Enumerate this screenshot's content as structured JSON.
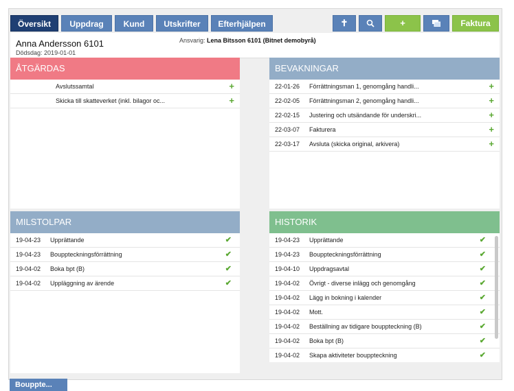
{
  "nav": {
    "tabs": [
      "Översikt",
      "Uppdrag",
      "Kund",
      "Utskrifter",
      "Efterhjälpen"
    ],
    "active_tab": "Översikt"
  },
  "toolbar": {
    "pin_icon": "pin-icon",
    "search_icon": "search-icon",
    "add_label": "+",
    "window_icon": "window-icon",
    "invoice_label": "Faktura"
  },
  "header": {
    "client_name": "Anna Andersson 6101",
    "death_label": "Dödsdag:",
    "death_date": "2019-01-01",
    "responsible_label": "Ansvarig:",
    "responsible_value": "Lena Bitsson 6101 (Bitnet demobyrå)"
  },
  "atgardas": {
    "title": "ÅTGÄRDAS",
    "color": "#f07a85",
    "rows": [
      {
        "text": "Avslutssamtal"
      },
      {
        "text": "Skicka till skatteverket (inkl. bilagor oc..."
      }
    ]
  },
  "bevakningar": {
    "title": "BEVAKNINGAR",
    "color": "#93adc7",
    "rows": [
      {
        "date": "22-01-26",
        "text": "Förrättningsman 1, genomgång handli..."
      },
      {
        "date": "22-02-05",
        "text": "Förrättningsman 2, genomgång handli..."
      },
      {
        "date": "22-02-15",
        "text": "Justering och utsändande för underskri..."
      },
      {
        "date": "22-03-07",
        "text": "Fakturera"
      },
      {
        "date": "22-03-17",
        "text": "Avsluta (skicka original, arkivera)"
      }
    ]
  },
  "milstolpar": {
    "title": "MILSTOLPAR",
    "color": "#93adc7",
    "rows": [
      {
        "date": "19-04-23",
        "text": "Upprättande"
      },
      {
        "date": "19-04-23",
        "text": "Bouppteckningsförrättning"
      },
      {
        "date": "19-04-02",
        "text": "Boka bpt (B)"
      },
      {
        "date": "19-04-02",
        "text": "Uppläggning av ärende"
      }
    ]
  },
  "historik": {
    "title": "HISTORIK",
    "color": "#7fbf8e",
    "rows": [
      {
        "date": "19-04-23",
        "text": "Upprättande"
      },
      {
        "date": "19-04-23",
        "text": "Bouppteckningsförrättning"
      },
      {
        "date": "19-04-10",
        "text": "Uppdragsavtal"
      },
      {
        "date": "19-04-02",
        "text": "Övrigt - diverse inlägg och genomgång"
      },
      {
        "date": "19-04-02",
        "text": "Lägg in bokning i kalender"
      },
      {
        "date": "19-04-02",
        "text": "Mott."
      },
      {
        "date": "19-04-02",
        "text": "Beställning av tidigare bouppteckning (B)"
      },
      {
        "date": "19-04-02",
        "text": "Boka bpt (B)"
      },
      {
        "date": "19-04-02",
        "text": "Skapa aktiviteter bouppteckning"
      }
    ]
  },
  "bottom_tab": {
    "label": "Bouppte..."
  }
}
